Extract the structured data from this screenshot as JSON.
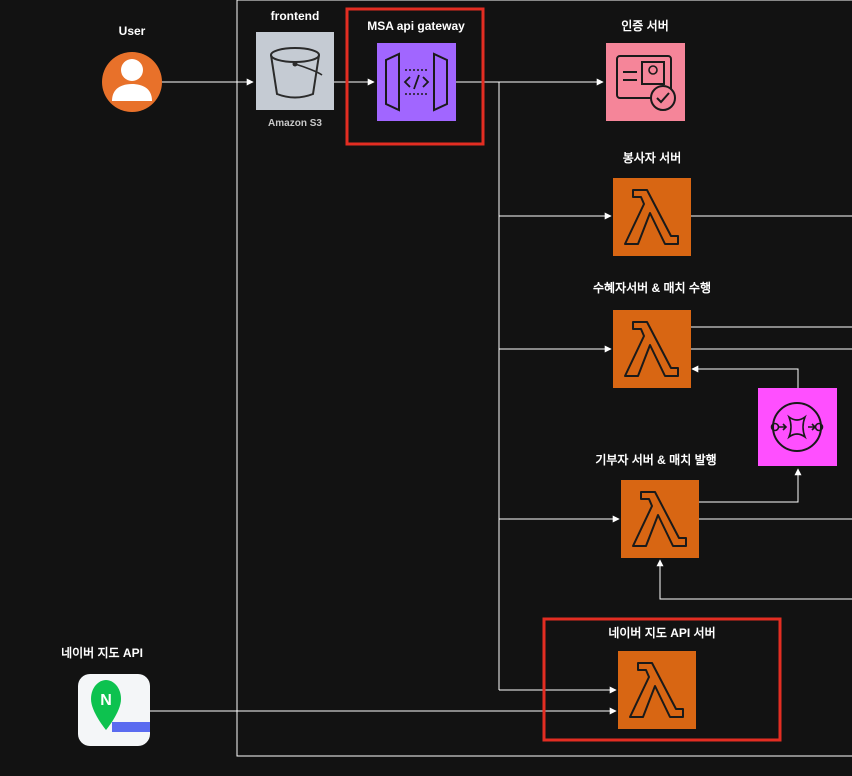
{
  "nodes": {
    "user": {
      "label": "User"
    },
    "frontend": {
      "label": "frontend",
      "sublabel": "Amazon S3"
    },
    "gateway": {
      "label": "MSA api gateway"
    },
    "auth": {
      "label": "인증 서버"
    },
    "volunteer": {
      "label": "봉사자 서버"
    },
    "recipient": {
      "label": "수혜자서버 & 매치 수행"
    },
    "donor": {
      "label": "기부자 서버 & 매치 발행"
    },
    "naver_server": {
      "label": "네이버 지도 API 서버"
    },
    "naver_api": {
      "label": "네이버 지도 API",
      "logo_letter": "N"
    }
  },
  "colors": {
    "background": "#121212",
    "lambda": "#D86613",
    "gateway": "#A166FF",
    "auth": "#F58599",
    "queue": "#FF4FFF",
    "s3": "#C5CBD3",
    "user": "#E8712A",
    "highlight": "#E32D22"
  }
}
